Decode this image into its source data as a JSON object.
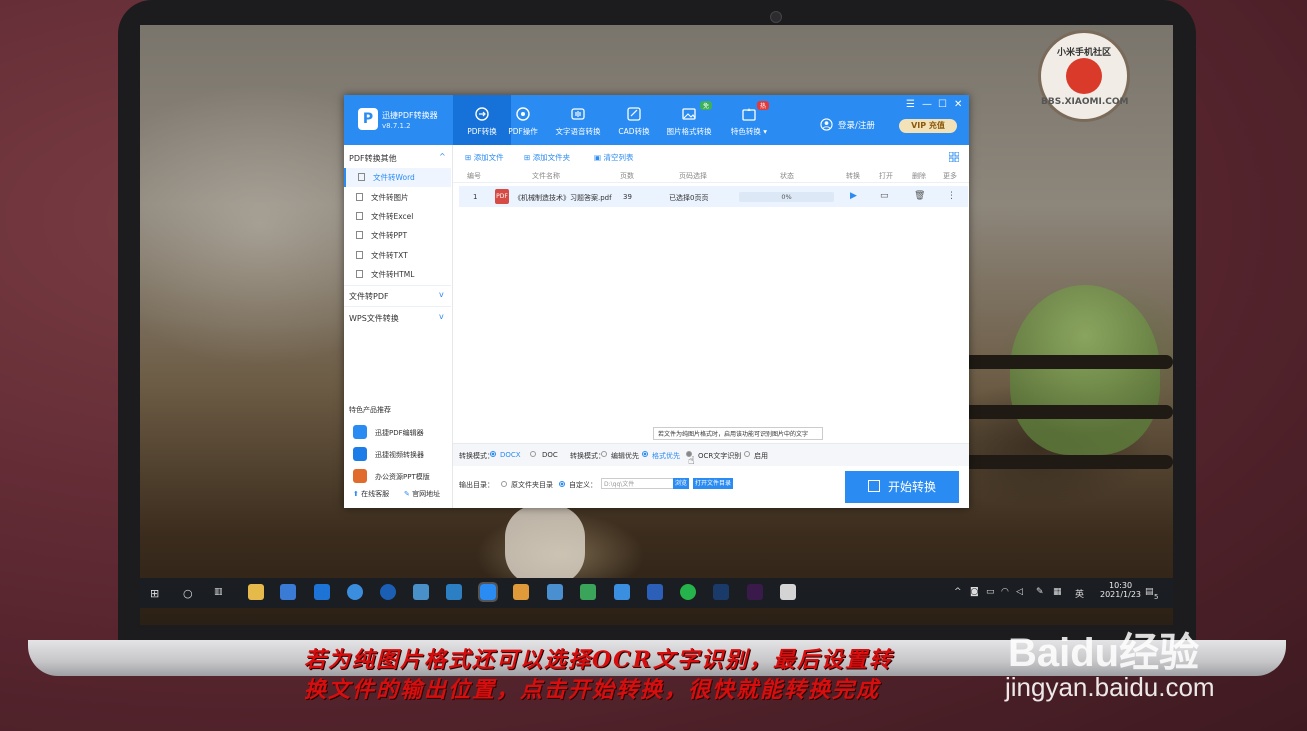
{
  "app": {
    "name": "迅捷PDF转换器",
    "version": "v8.7.1.2",
    "nav": [
      {
        "label": "PDF转换",
        "icon": "pdf-convert-icon"
      },
      {
        "label": "PDF操作",
        "icon": "pdf-operate-icon"
      },
      {
        "label": "文字语音转换",
        "icon": "voice-icon"
      },
      {
        "label": "CAD转换",
        "icon": "cad-icon"
      },
      {
        "label": "图片格式转换",
        "icon": "image-icon",
        "badge": "免"
      },
      {
        "label": "特色转换",
        "icon": "feature-icon",
        "badge": "热"
      }
    ],
    "login": "登录/注册",
    "vip": "VIP 充值",
    "window_controls": [
      "☰",
      "—",
      "☐",
      "✕"
    ]
  },
  "sidebar": {
    "section1": "PDF转换其他",
    "items": [
      "文件转Word",
      "文件转图片",
      "文件转Excel",
      "文件转PPT",
      "文件转TXT",
      "文件转HTML"
    ],
    "section2": "文件转PDF",
    "section3": "WPS文件转换",
    "rec_title": "特色产品推荐",
    "rec_items": [
      "迅捷PDF编辑器",
      "迅捷视频转换器",
      "办公资源PPT模版"
    ],
    "footer_left": "在线客服",
    "footer_right": "官网地址"
  },
  "toolbar": {
    "add_file": "添加文件",
    "add_folder": "添加文件夹",
    "clear_list": "清空列表"
  },
  "table": {
    "headers": [
      "编号",
      "文件名称",
      "页数",
      "页码选择",
      "状态",
      "转换",
      "打开",
      "删除",
      "更多"
    ],
    "rows": [
      {
        "index": "1",
        "name": "《机械制造技术》习题答案.pdf",
        "pages": "39",
        "page_select": "已选择0页页",
        "progress": 0,
        "progress_text": "0%"
      }
    ]
  },
  "tooltip": "若文件为纯图片格式时，启用该功能可识别图片中的文字",
  "mode": {
    "label": "转换模式：",
    "opt_docx": "DOCX",
    "opt_doc": "DOC",
    "mode_label": "转换模式：",
    "opt_edit": "编辑优先",
    "opt_format": "格式优先",
    "opt_ocr": "OCR文字识别",
    "opt_enable": "启用"
  },
  "output": {
    "label": "输出目录：",
    "opt_original": "原文件夹目录",
    "opt_custom": "自定义：",
    "path": "D:\\qq\\文件",
    "browse": "浏览",
    "open_folder": "打开文件目录"
  },
  "start_button": "开始转换",
  "taskbar": {
    "time": "10:30",
    "date": "2021/1/23",
    "ime": "英",
    "notify_count": "5"
  },
  "watermark": {
    "badge_top": "小米手机社区",
    "badge_bottom": "BBS.XIAOMI.COM",
    "main": "Baidu经验",
    "url": "jingyan.baidu.com"
  },
  "caption": {
    "line1": "若为纯图片格式还可以选择OCR文字识别，最后设置转",
    "line2": "换文件的输出位置，点击开始转换，很快就能转换完成"
  },
  "colors": {
    "accent": "#2a8bf2",
    "caption": "#d80e0e"
  }
}
